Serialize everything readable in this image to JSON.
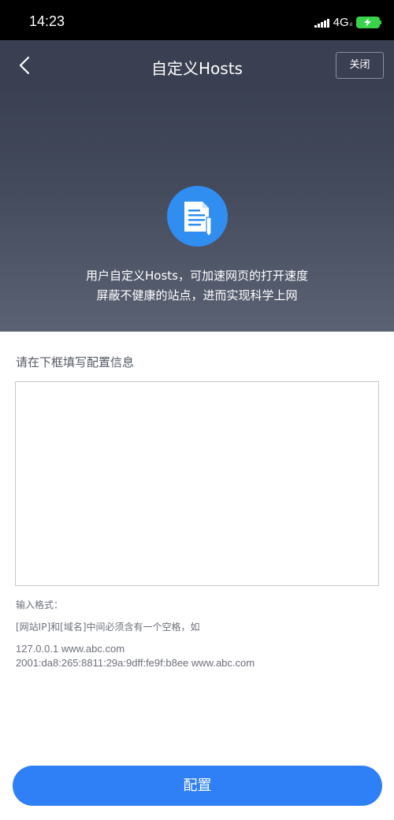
{
  "status_bar": {
    "time": "14:23",
    "network": "4G",
    "network_sub": "ıl",
    "icons": [
      "signal-icon",
      "battery-charging-icon"
    ]
  },
  "nav": {
    "title": "自定义Hosts",
    "close_label": "关闭",
    "icons": [
      "back-icon"
    ]
  },
  "hero": {
    "icon": "document-icon",
    "line1": "用户自定义Hosts，可加速网页的打开速度",
    "line2": "屏蔽不健康的站点，进而实现科学上网"
  },
  "form": {
    "label": "请在下框填写配置信息",
    "input_value": ""
  },
  "help": {
    "title": "输入格式：",
    "rule": "[网站IP]和[域名]中间必须含有一个空格，如",
    "example_ipv4": "127.0.0.1 www.abc.com",
    "example_ipv6": "2001:da8:265:8811:29a:9dff:fe9f:b8ee www.abc.com"
  },
  "actions": {
    "config_label": "配置"
  },
  "colors": {
    "primary": "#2f80f6",
    "nav_bg": "#3a4051",
    "icon_bg": "#2f8ef0",
    "battery": "#39d24c"
  }
}
